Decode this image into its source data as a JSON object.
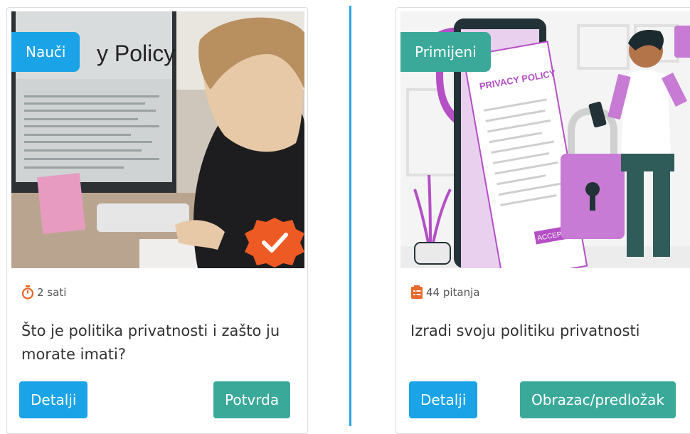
{
  "cards": [
    {
      "tag": "Nauči",
      "meta_text": "2 sati",
      "meta_icon": "stopwatch-icon",
      "title": "Što je politika privatnosti i zašto ju morate imati?",
      "buttons": {
        "details": "Detalji",
        "action": "Potvrda"
      },
      "image_text": "y Policy",
      "badge_icon": "verified-check-icon"
    },
    {
      "tag": "Primijeni",
      "meta_text": "44 pitanja",
      "meta_icon": "checklist-icon",
      "title": "Izradi svoju politiku privatnosti",
      "buttons": {
        "details": "Detalji",
        "action": "Obrazac/predložak"
      },
      "image_text": "PRIVACY POLICY",
      "image_button": "ACCEPT"
    }
  ],
  "colors": {
    "accent_blue": "#1aa3e6",
    "accent_teal": "#3aa99a",
    "meta_icon": "#e8672b"
  }
}
